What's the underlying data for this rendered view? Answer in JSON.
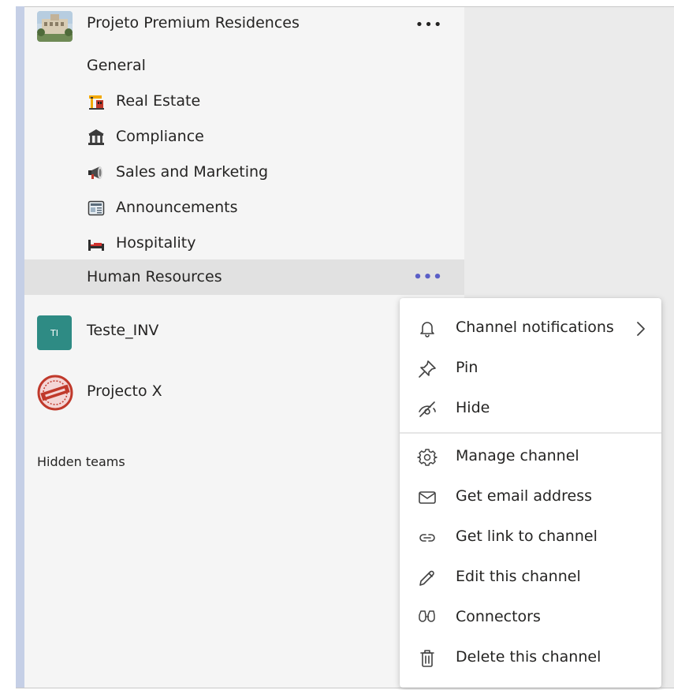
{
  "team": {
    "name": "Projeto Premium Residences",
    "more_label": "•••"
  },
  "channels": [
    {
      "label": "General",
      "icon": "none"
    },
    {
      "label": "Real Estate",
      "icon": "construction-crane-icon"
    },
    {
      "label": "Compliance",
      "icon": "classical-building-icon"
    },
    {
      "label": "Sales and Marketing",
      "icon": "megaphone-icon"
    },
    {
      "label": "Announcements",
      "icon": "newspaper-icon"
    },
    {
      "label": "Hospitality",
      "icon": "bed-icon"
    },
    {
      "label": "Human Resources",
      "icon": "none",
      "selected": true,
      "more_label": "•••"
    }
  ],
  "other_teams": [
    {
      "label": "Teste_INV",
      "avatar_text": "TI",
      "avatar_color": "#2e8b84"
    },
    {
      "label": "Projecto X",
      "avatar": "red-stamp-logo"
    }
  ],
  "hidden_teams_label": "Hidden teams",
  "context_menu": {
    "items": [
      {
        "label": "Channel notifications",
        "icon": "bell-icon",
        "has_submenu": true
      },
      {
        "label": "Pin",
        "icon": "pin-icon"
      },
      {
        "label": "Hide",
        "icon": "eye-off-icon"
      },
      {
        "label": "Manage channel",
        "icon": "gear-icon"
      },
      {
        "label": "Get email address",
        "icon": "envelope-icon"
      },
      {
        "label": "Get link to channel",
        "icon": "link-icon"
      },
      {
        "label": "Edit this channel",
        "icon": "pencil-icon"
      },
      {
        "label": "Connectors",
        "icon": "connectors-icon"
      },
      {
        "label": "Delete this channel",
        "icon": "trash-icon"
      }
    ]
  },
  "colors": {
    "accent": "#5b5fc7",
    "sidebar_bg": "#f5f5f5",
    "selected_bg": "#e1e1e1",
    "right_pane_bg": "#ebebeb",
    "teams_avatar": "#2e8b84"
  }
}
